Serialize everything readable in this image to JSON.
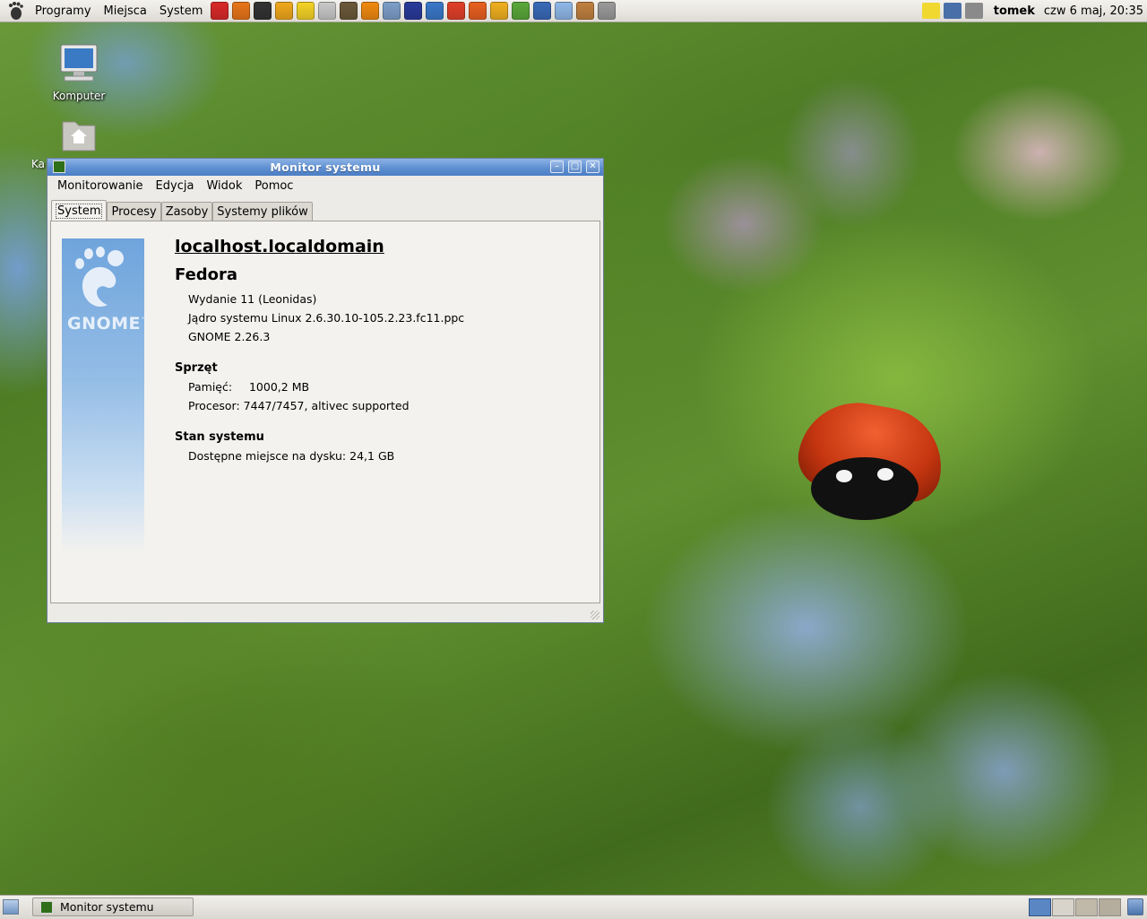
{
  "top_panel": {
    "menus": [
      "Programy",
      "Miejsca",
      "System"
    ],
    "launchers": [
      {
        "icon": "lastfm-icon",
        "color": "#d92a2a"
      },
      {
        "icon": "firefox-icon",
        "color": "#e8751a"
      },
      {
        "icon": "terminal-icon",
        "color": "#333333"
      },
      {
        "icon": "tools-x-icon",
        "color": "#f0a81c"
      },
      {
        "icon": "sun-icon",
        "color": "#f5d327"
      },
      {
        "icon": "mail-icon",
        "color": "#c9c9c9"
      },
      {
        "icon": "gimp-icon",
        "color": "#6b5a3a"
      },
      {
        "icon": "vlc-icon",
        "color": "#f08a10"
      },
      {
        "icon": "mplayer-icon",
        "color": "#7d9fc9"
      },
      {
        "icon": "mms-icon",
        "color": "#2a3a9a"
      },
      {
        "icon": "browser-globe-icon",
        "color": "#3a78c9"
      },
      {
        "icon": "hib-icon",
        "color": "#e0402a"
      },
      {
        "icon": "office-draw-icon",
        "color": "#e86020"
      },
      {
        "icon": "office-impress-icon",
        "color": "#f0b020"
      },
      {
        "icon": "office-calc-icon",
        "color": "#5aa83a"
      },
      {
        "icon": "office-writer-icon",
        "color": "#3a6ab8"
      },
      {
        "icon": "download-icon",
        "color": "#8fb8e8"
      },
      {
        "icon": "rabbit-icon",
        "color": "#c08040"
      },
      {
        "icon": "cabinet-icon",
        "color": "#9a9a9a"
      }
    ],
    "tray_icons": [
      {
        "icon": "notes-icon",
        "color": "#f0d830"
      },
      {
        "icon": "network-icon",
        "color": "#4a6fa8"
      },
      {
        "icon": "volume-icon",
        "color": "#8a8a8a"
      }
    ],
    "user": "tomek",
    "clock": "czw  6 maj, 20:35"
  },
  "desktop": {
    "icons": [
      {
        "label": "Komputer"
      },
      {
        "label": "Ka"
      }
    ]
  },
  "window": {
    "title": "Monitor systemu",
    "menus": [
      "Monitorowanie",
      "Edycja",
      "Widok",
      "Pomoc"
    ],
    "tabs": [
      "System",
      "Procesy",
      "Zasoby",
      "Systemy plików"
    ],
    "active_tab": "System",
    "logo_text": "GNOME",
    "logo_tm": "™",
    "system": {
      "hostname": "localhost.localdomain",
      "distro": "Fedora",
      "distro_lines": [
        "Wydanie 11 (Leonidas)",
        "Jądro systemu Linux 2.6.30.10-105.2.23.fc11.ppc",
        "GNOME 2.26.3"
      ],
      "hardware_heading": "Sprzęt",
      "memory_label": "Pamięć:",
      "memory_value": "1000,2 MB",
      "cpu_label": "Procesor:",
      "cpu_value": "7447/7457, altivec supported",
      "status_heading": "Stan systemu",
      "disk_label": "Dostępne miejsce na dysku:",
      "disk_value": "24,1 GB"
    }
  },
  "bottom_panel": {
    "task_label": "Monitor systemu",
    "workspaces": [
      {
        "name": "workspace-1",
        "color": "#5a86c4",
        "active": true
      },
      {
        "name": "workspace-2",
        "color": "#d8d4cc",
        "active": false
      },
      {
        "name": "workspace-3",
        "color": "#c0b8a8",
        "active": false
      },
      {
        "name": "workspace-4",
        "color": "#b4ac9c",
        "active": false
      }
    ]
  }
}
